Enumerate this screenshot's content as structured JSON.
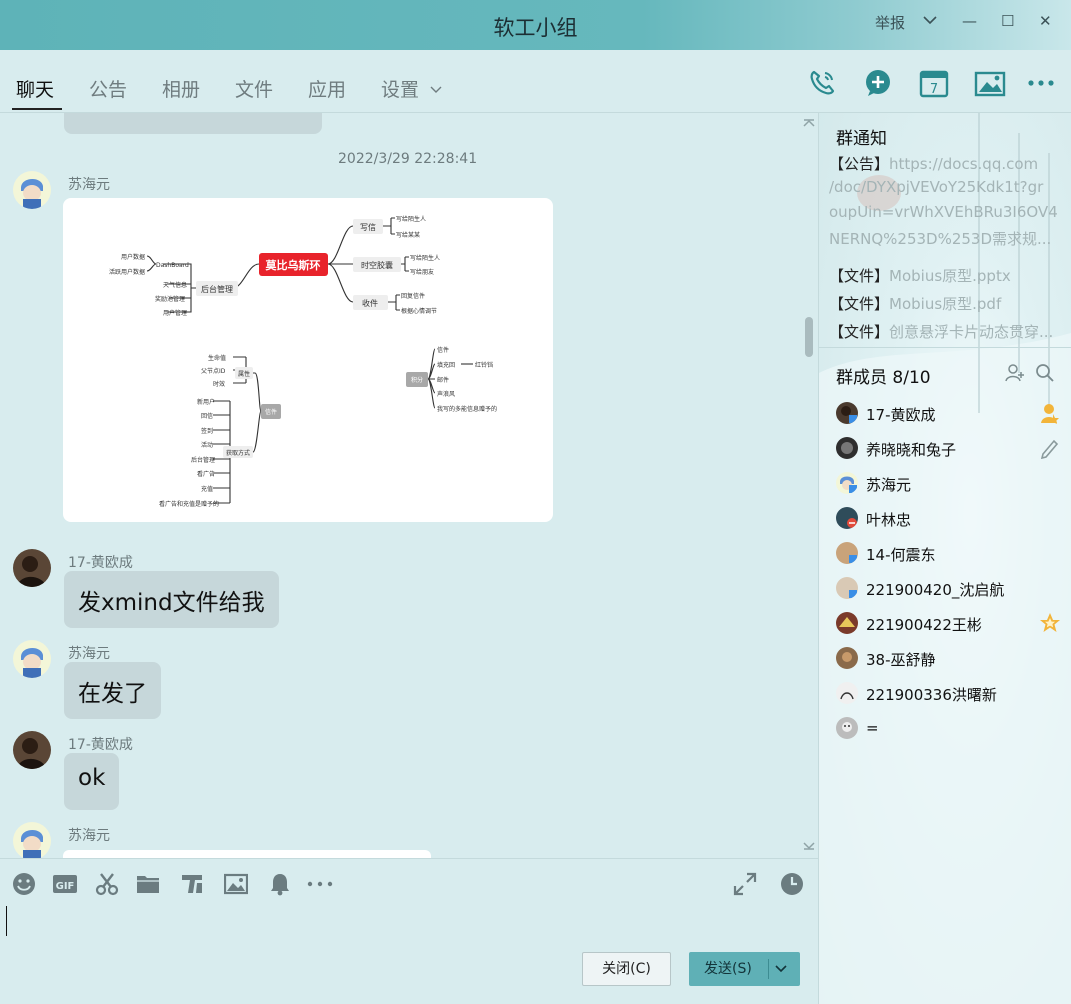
{
  "window": {
    "title": "软工小组",
    "report": "举报",
    "min": "—",
    "max": "☐",
    "close": "✕"
  },
  "tabs": [
    {
      "label": "聊天",
      "active": true
    },
    {
      "label": "公告",
      "active": false
    },
    {
      "label": "相册",
      "active": false
    },
    {
      "label": "文件",
      "active": false
    },
    {
      "label": "应用",
      "active": false
    },
    {
      "label": "设置",
      "active": false
    }
  ],
  "toolbar": {
    "calendar_day": "7"
  },
  "chat": {
    "timestamp": "2022/3/29 22:28:41",
    "messages": [
      {
        "sender": "苏海元",
        "type": "image"
      },
      {
        "sender": "17-黄欧成",
        "text": "发xmind文件给我"
      },
      {
        "sender": "苏海元",
        "text": "在发了"
      },
      {
        "sender": "17-黄欧成",
        "text": "ok"
      },
      {
        "sender": "苏海元",
        "type": "image"
      }
    ],
    "mindmap": {
      "center": "莫比乌斯环",
      "nodes": [
        "写信",
        "时空胶囊",
        "收件",
        "后台管理",
        "用户数据",
        "DashBoard",
        "天气信息",
        "活跃用户数据",
        "天气播报",
        "奖励池管理",
        "用户管理",
        "写给陌生人",
        "写给某某",
        "写给陌生人",
        "写给朋友",
        "回复信件",
        "根据心情调节",
        "生命值",
        "父节点ID",
        "时效",
        "属性",
        "新用户",
        "回信",
        "签到",
        "活动",
        "后台管理",
        "看广告",
        "充值",
        "看广告和充值是赠予的",
        "获取方式",
        "信件",
        "积分",
        "信件",
        "填充回",
        "红铃铛",
        "邮件",
        "声浪风",
        "我写的多能信息赠予的"
      ]
    }
  },
  "buttons": {
    "close": "关闭(C)",
    "send": "发送(S)"
  },
  "panel": {
    "notice_title": "群通知",
    "notice_lines": [
      {
        "tag": "【公告】",
        "text": "https://docs.qq.com"
      },
      {
        "tag": "",
        "text": "/doc/DYXpjVEVoY25Kdk1t?gr"
      },
      {
        "tag": "",
        "text": "oupUin=vrWhXVEhBRu3I6OV4"
      },
      {
        "tag": "",
        "text": "NERNQ%253D%253D需求规..."
      },
      {
        "tag": "【文件】",
        "text": "Mobius原型.pptx"
      },
      {
        "tag": "【文件】",
        "text": "Mobius原型.pdf"
      },
      {
        "tag": "【文件】",
        "text": "创意悬浮卡片动态贯穿..."
      }
    ],
    "members_title": "群成员 8/10",
    "members": [
      {
        "name": "17-黄欧成",
        "color": "#4a3a2e",
        "badge": "owner"
      },
      {
        "name": "养晓晓和兔子",
        "color": "#2e2e2e",
        "badge": "edit"
      },
      {
        "name": "苏海元",
        "color": "#7fb0e0",
        "badge": ""
      },
      {
        "name": "叶林忠",
        "color": "#2f4c5a",
        "badge": ""
      },
      {
        "name": "14-何震东",
        "color": "#c9a37a",
        "badge": ""
      },
      {
        "name": "221900420_沈启航",
        "color": "#d9c9b5",
        "badge": ""
      },
      {
        "name": "221900422王彬",
        "color": "#7a3a2a",
        "badge": "admin"
      },
      {
        "name": "38-巫舒静",
        "color": "#8a6a4a",
        "badge": ""
      },
      {
        "name": "221900336洪曙新",
        "color": "#f0f0f0",
        "badge": ""
      },
      {
        "name": "=",
        "color": "#bcbcbc",
        "badge": ""
      }
    ]
  },
  "colors": {
    "accent": "#5fb0b6",
    "bubble": "#c6d7da",
    "background": "#d8ecee",
    "mindmap_center": "#e8232b"
  }
}
